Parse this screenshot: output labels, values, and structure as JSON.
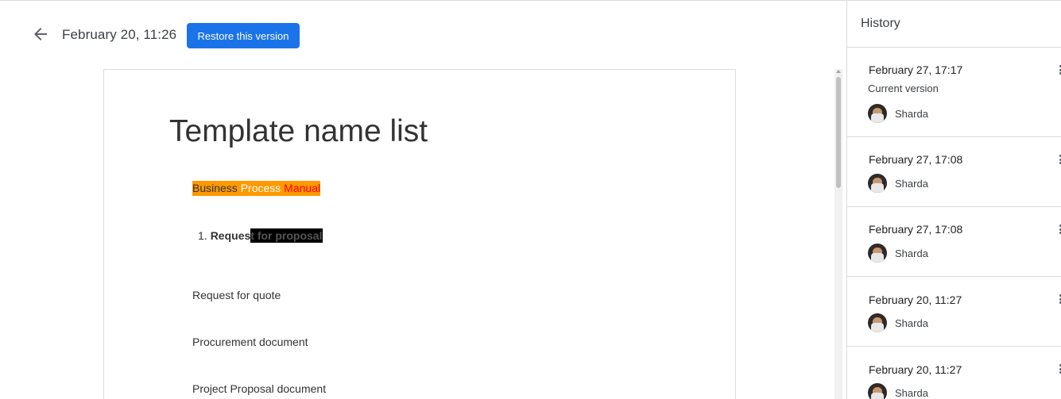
{
  "header": {
    "version_title": "February 20, 11:26",
    "restore_label": "Restore this version"
  },
  "document": {
    "title": "Template name list",
    "highlight_line": {
      "word1": "Business ",
      "word2": "Process ",
      "word3": "Manual"
    },
    "list_item": {
      "number": "1.",
      "text_a": "Reques",
      "text_b": "t for proposal"
    },
    "paragraphs": [
      "Request for quote",
      "Procurement document",
      "Project Proposal document"
    ]
  },
  "history": {
    "title": "History",
    "entries": [
      {
        "date": "February 27, 17:17",
        "subtitle": "Current version",
        "user": "Sharda"
      },
      {
        "date": "February 27, 17:08",
        "user": "Sharda"
      },
      {
        "date": "February 27, 17:08",
        "user": "Sharda"
      },
      {
        "date": "February 20, 11:27",
        "user": "Sharda"
      },
      {
        "date": "February 20, 11:27",
        "user": "Sharda"
      }
    ]
  },
  "colors": {
    "accent": "#1a73e8",
    "highlight": "#ff9900"
  }
}
